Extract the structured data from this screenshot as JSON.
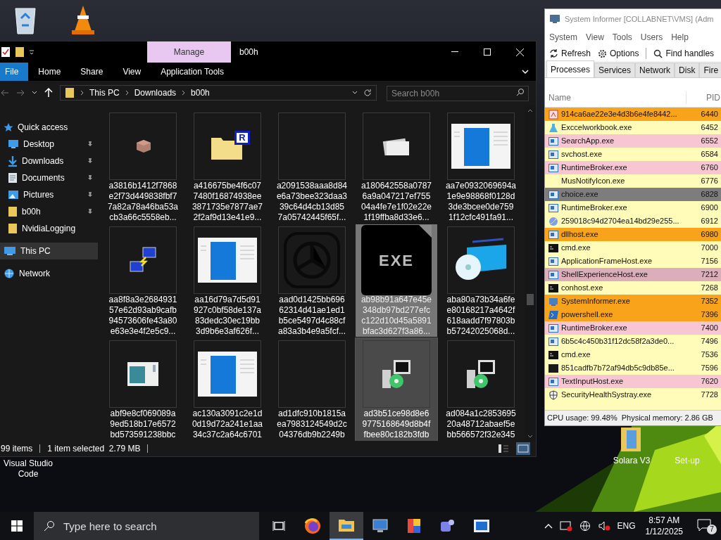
{
  "desktop_icons": [
    {
      "kind": "recycle-bin"
    },
    {
      "kind": "vlc"
    },
    {
      "kind": "vscode",
      "label": "Visual Studio\nCode"
    },
    {
      "kind": "folder",
      "label": "Solara V3"
    },
    {
      "kind": "none",
      "label": "Set-up"
    }
  ],
  "explorer": {
    "title": "b00h",
    "context_tab": "Manage",
    "ribbon_tabs": [
      {
        "label": "File",
        "selected": true
      },
      {
        "label": "Home",
        "selected": false
      },
      {
        "label": "Share",
        "selected": false
      },
      {
        "label": "View",
        "selected": false
      },
      {
        "label": "Application Tools",
        "selected": false
      }
    ],
    "breadcrumb": [
      "This PC",
      "Downloads",
      "b00h"
    ],
    "search": {
      "placeholder": "Search b00h"
    },
    "nav": [
      {
        "label": "Quick access",
        "kind": "star",
        "pinned": false,
        "selected": false
      },
      {
        "label": "Desktop",
        "kind": "desktop",
        "pinned": true,
        "selected": false
      },
      {
        "label": "Downloads",
        "kind": "download",
        "pinned": true,
        "selected": false
      },
      {
        "label": "Documents",
        "kind": "document",
        "pinned": true,
        "selected": false
      },
      {
        "label": "Pictures",
        "kind": "pictures",
        "pinned": true,
        "selected": false
      },
      {
        "label": "b00h",
        "kind": "folder",
        "pinned": true,
        "selected": false
      },
      {
        "label": "NvidiaLogging",
        "kind": "folder",
        "pinned": false,
        "selected": false
      },
      {
        "label": "This PC",
        "kind": "pc",
        "pinned": false,
        "selected": true
      },
      {
        "label": "Network",
        "kind": "network",
        "pinned": false,
        "selected": false
      }
    ],
    "files": [
      {
        "kind": "brick",
        "name_lines": [
          "a3816b1412f7868",
          "e2f73d449838fbf7",
          "7a82a78a46ba53a",
          "cb3a66c5558eb..."
        ],
        "selected": false,
        "hovered": false
      },
      {
        "kind": "folder-r",
        "badge": "R",
        "name_lines": [
          "a416675be4f6c07",
          "7480f16874938ee",
          "3871735e7877ae7",
          "2f2af9d13e41e9..."
        ],
        "selected": false,
        "hovered": false
      },
      {
        "kind": "blank",
        "name_lines": [
          "a2091538aaa8d84",
          "e6a73bee323daa3",
          "39c64d4cb13d85",
          "7a05742445f65f..."
        ],
        "selected": false,
        "hovered": false
      },
      {
        "kind": "cards",
        "name_lines": [
          "a180642558a0787",
          "6a9a047217ef755",
          "04a4fe7e1f02e22e",
          "1f19ffba8d33e6..."
        ],
        "selected": false,
        "hovered": false
      },
      {
        "kind": "screenshot",
        "name_lines": [
          "aa7e0932069694a",
          "1e9e98868f0128d",
          "3de3bcee0de759",
          "1f12cfc491fa91..."
        ],
        "selected": false,
        "hovered": false
      },
      {
        "kind": "network",
        "name_lines": [
          "aa8f8a3e2684931",
          "57e62d93ab9cafb",
          "94573606fe43a80",
          "e63e3e4f2e5c9..."
        ],
        "selected": false,
        "hovered": false
      },
      {
        "kind": "screenshot",
        "name_lines": [
          "aa16d79a7d5d91",
          "927c0bf58de137a",
          "83dedc30ec19bb",
          "3d9b6e3af626f..."
        ],
        "selected": false,
        "hovered": false
      },
      {
        "kind": "ring",
        "name_lines": [
          "aad0d1425bb696",
          "62314d41ae1ed1",
          "b5ce5497d4c88cf",
          "a83a3b4e9a5fcf..."
        ],
        "selected": false,
        "hovered": false
      },
      {
        "kind": "exe",
        "badge": "EXE",
        "name_lines": [
          "ab98b91a647e45e",
          "348db97bd277efc",
          "c122d10d45a5891",
          "bfac3d627f3a86..."
        ],
        "selected": true,
        "hovered": false
      },
      {
        "kind": "disc-box",
        "name_lines": [
          "aba80a73b34a6fe",
          "e80168217a4642f",
          "618aadd7f97803b",
          "b57242025068d..."
        ],
        "selected": false,
        "hovered": false
      },
      {
        "kind": "small-window",
        "name_lines": [
          "abf9e8cf069089a",
          "9ed518b17e6572",
          "bd573591238bbc"
        ],
        "selected": false,
        "hovered": false
      },
      {
        "kind": "screenshot",
        "name_lines": [
          "ac130a3091c2e1d",
          "0d19d72a241e1aa",
          "34c37c2a64c6701"
        ],
        "selected": false,
        "hovered": false
      },
      {
        "kind": "blank",
        "name_lines": [
          "ad1dfc910b1815a",
          "ea7983124549d2c",
          "04376db9b2249b"
        ],
        "selected": false,
        "hovered": false
      },
      {
        "kind": "installer",
        "name_lines": [
          "ad3b51ce98d8e6",
          "9775168649d8b4f",
          "fbee80c182b3fdb"
        ],
        "selected": false,
        "hovered": true
      },
      {
        "kind": "installer",
        "name_lines": [
          "ad084a1c2853695",
          "20a48712abaef5e",
          "bb566572f32e345"
        ],
        "selected": false,
        "hovered": false
      }
    ],
    "status": {
      "count": "99 items",
      "selection": "1 item selected  2.79 MB"
    }
  },
  "system_informer": {
    "title": "System Informer [COLLABNET\\VMS] (Adm",
    "menu": [
      "System",
      "View",
      "Tools",
      "Users",
      "Help"
    ],
    "toolbar": [
      {
        "label": "Refresh",
        "kind": "refresh"
      },
      {
        "label": "Options",
        "kind": "gear"
      },
      {
        "label": "Find handles",
        "kind": "search"
      }
    ],
    "tabs": [
      {
        "label": "Processes",
        "selected": true
      },
      {
        "label": "Services",
        "selected": false
      },
      {
        "label": "Network",
        "selected": false
      },
      {
        "label": "Disk",
        "selected": false
      },
      {
        "label": "Fire",
        "selected": false
      }
    ],
    "columns": [
      "Name",
      "PID"
    ],
    "processes": [
      {
        "name": "914ca6ae22e3e4d3b6e4fe8442...",
        "pid": "6440",
        "color": "#f9a31b",
        "kind": "app-red"
      },
      {
        "name": "Exccelworkbook.exe",
        "pid": "6452",
        "color": "#fffbb8",
        "kind": "flask"
      },
      {
        "name": "SearchApp.exe",
        "pid": "6552",
        "color": "#f8c6d2",
        "kind": "window"
      },
      {
        "name": "svchost.exe",
        "pid": "6584",
        "color": "#fffbb8",
        "kind": "window"
      },
      {
        "name": "RuntimeBroker.exe",
        "pid": "6760",
        "color": "#f8c6d2",
        "kind": "window"
      },
      {
        "name": "MusNotifyIcon.exe",
        "pid": "6776",
        "color": "#fffbb8",
        "kind": "none"
      },
      {
        "name": "choice.exe",
        "pid": "6828",
        "color": "#7d7d7d",
        "kind": "window"
      },
      {
        "name": "RuntimeBroker.exe",
        "pid": "6900",
        "color": "#fffbb8",
        "kind": "window"
      },
      {
        "name": "259018c94d2704ea14bd29e255...",
        "pid": "6912",
        "color": "#fffbb8",
        "kind": "swirl"
      },
      {
        "name": "dllhost.exe",
        "pid": "6980",
        "color": "#f9a31b",
        "kind": "window"
      },
      {
        "name": "cmd.exe",
        "pid": "7000",
        "color": "#fffbb8",
        "kind": "console"
      },
      {
        "name": "ApplicationFrameHost.exe",
        "pid": "7156",
        "color": "#fffbb8",
        "kind": "window"
      },
      {
        "name": "ShellExperienceHost.exe",
        "pid": "7212",
        "color": "#dcaebb",
        "kind": "window"
      },
      {
        "name": "conhost.exe",
        "pid": "7268",
        "color": "#fffbb8",
        "kind": "console"
      },
      {
        "name": "SystemInformer.exe",
        "pid": "7352",
        "color": "#f9a31b",
        "kind": "monitor"
      },
      {
        "name": "powershell.exe",
        "pid": "7396",
        "color": "#f9a31b",
        "kind": "powershell"
      },
      {
        "name": "RuntimeBroker.exe",
        "pid": "7400",
        "color": "#f8c6d2",
        "kind": "window"
      },
      {
        "name": "6b5c4c450b31f12dc58f2a3de0...",
        "pid": "7496",
        "color": "#fffbb8",
        "kind": "window"
      },
      {
        "name": "cmd.exe",
        "pid": "7536",
        "color": "#fffbb8",
        "kind": "console"
      },
      {
        "name": "851cadfb7b72af94db5c9db85e...",
        "pid": "7596",
        "color": "#fffbb8",
        "kind": "dark-box"
      },
      {
        "name": "TextInputHost.exe",
        "pid": "7620",
        "color": "#f8c6d2",
        "kind": "window"
      },
      {
        "name": "SecurityHealthSystray.exe",
        "pid": "7728",
        "color": "#fffbb8",
        "kind": "shield"
      }
    ],
    "status": [
      "CPU usage: 99.48%",
      "Physical memory: 2.86 GB"
    ]
  },
  "taskbar": {
    "search_placeholder": "Type here to search",
    "apps": [
      {
        "kind": "task-view",
        "active": false
      },
      {
        "kind": "firefox",
        "active": false
      },
      {
        "kind": "explorer",
        "active": true
      },
      {
        "kind": "remote",
        "active": false
      },
      {
        "kind": "colorful",
        "active": false
      },
      {
        "kind": "teams",
        "active": false
      },
      {
        "kind": "blue-window",
        "active": false
      }
    ],
    "language": "ENG",
    "time": "8:57 AM",
    "date": "1/12/2025",
    "notifications": "7"
  }
}
